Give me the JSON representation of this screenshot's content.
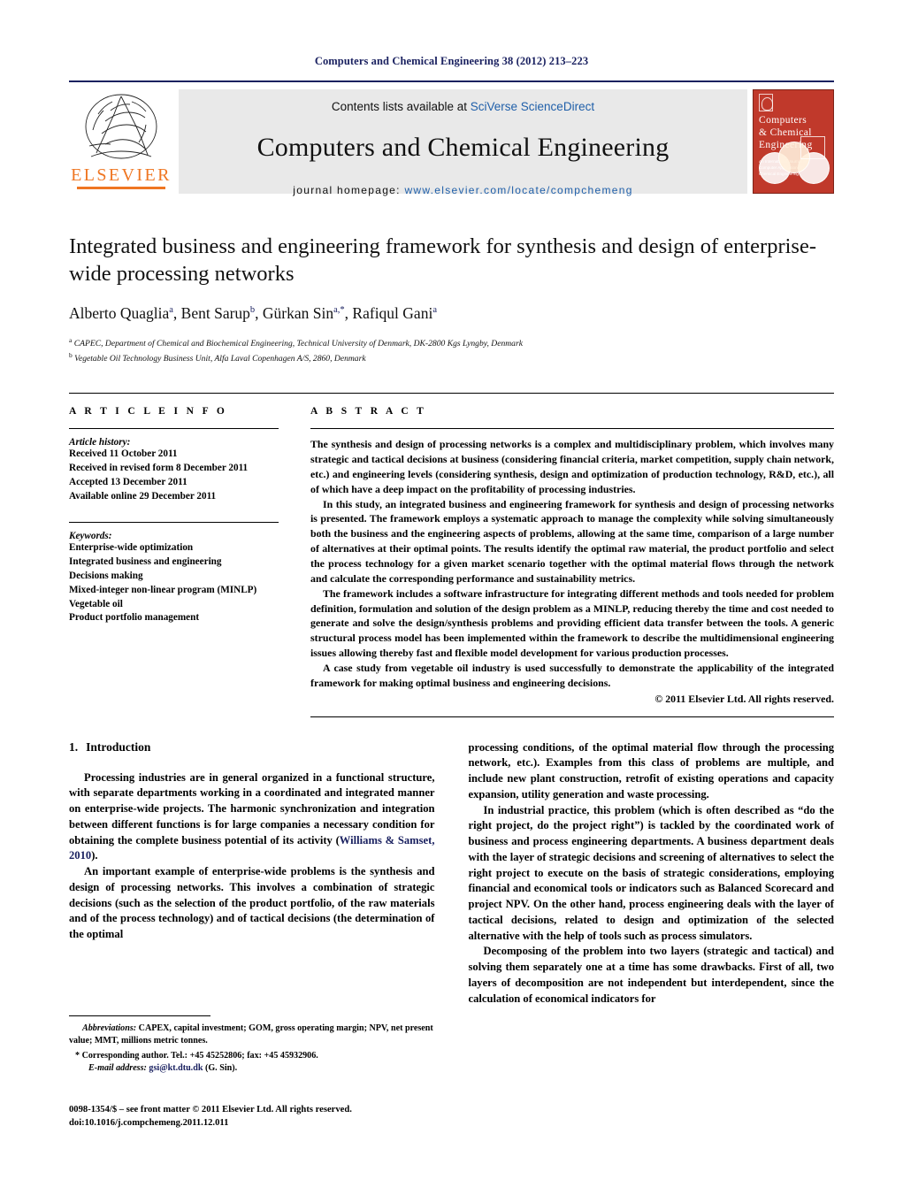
{
  "running_head": "Computers and Chemical Engineering 38 (2012) 213–223",
  "masthead": {
    "contents_prefix": "Contents lists available at ",
    "contents_link": "SciVerse ScienceDirect",
    "journal_title": "Computers and Chemical Engineering",
    "homepage_label": "journal homepage:",
    "homepage_url": "www.elsevier.com/locate/compchemeng",
    "publisher": "ELSEVIER",
    "cover": {
      "title_line1": "Computers",
      "title_line2": "& Chemical",
      "title_line3": "Engineering",
      "subtitle": "An International Journal of Computer Applications in Chemical Engineering"
    }
  },
  "article": {
    "title": "Integrated business and engineering framework for synthesis and design of enterprise-wide processing networks",
    "authors": [
      {
        "name": "Alberto Quaglia",
        "marks": "a"
      },
      {
        "name": "Bent Sarup",
        "marks": "b"
      },
      {
        "name": "Gürkan Sin",
        "marks": "a,*"
      },
      {
        "name": "Rafiqul Gani",
        "marks": "a"
      }
    ],
    "affiliations": [
      {
        "mark": "a",
        "text": "CAPEC, Department of Chemical and Biochemical Engineering, Technical University of Denmark, DK-2800 Kgs Lyngby, Denmark"
      },
      {
        "mark": "b",
        "text": "Vegetable Oil Technology Business Unit, Alfa Laval Copenhagen A/S, 2860, Denmark"
      }
    ]
  },
  "article_info": {
    "heading": "A R T I C L E   I N F O",
    "history_label": "Article history:",
    "history": [
      "Received 11 October 2011",
      "Received in revised form 8 December 2011",
      "Accepted 13 December 2011",
      "Available online 29 December 2011"
    ],
    "keywords_label": "Keywords:",
    "keywords": [
      "Enterprise-wide optimization",
      "Integrated business and engineering",
      "Decisions making",
      "Mixed-integer non-linear program (MINLP)",
      "Vegetable oil",
      "Product portfolio management"
    ]
  },
  "abstract": {
    "heading": "A B S T R A C T",
    "paragraphs": [
      "The synthesis and design of processing networks is a complex and multidisciplinary problem, which involves many strategic and tactical decisions at business (considering financial criteria, market competition, supply chain network, etc.) and engineering levels (considering synthesis, design and optimization of production technology, R&D, etc.), all of which have a deep impact on the profitability of processing industries.",
      "In this study, an integrated business and engineering framework for synthesis and design of processing networks is presented. The framework employs a systematic approach to manage the complexity while solving simultaneously both the business and the engineering aspects of problems, allowing at the same time, comparison of a large number of alternatives at their optimal points. The results identify the optimal raw material, the product portfolio and select the process technology for a given market scenario together with the optimal material flows through the network and calculate the corresponding performance and sustainability metrics.",
      "The framework includes a software infrastructure for integrating different methods and tools needed for problem definition, formulation and solution of the design problem as a MINLP, reducing thereby the time and cost needed to generate and solve the design/synthesis problems and providing efficient data transfer between the tools. A generic structural process model has been implemented within the framework to describe the multidimensional engineering issues allowing thereby fast and flexible model development for various production processes.",
      "A case study from vegetable oil industry is used successfully to demonstrate the applicability of the integrated framework for making optimal business and engineering decisions."
    ],
    "copyright": "© 2011 Elsevier Ltd. All rights reserved."
  },
  "body": {
    "section_number": "1.",
    "section_title": "Introduction",
    "left_paragraphs": [
      "Processing industries are in general organized in a functional structure, with separate departments working in a coordinated and integrated manner on enterprise-wide projects. The harmonic synchronization and integration between different functions is for large companies a necessary condition for obtaining the complete business potential of its activity (",
      "An important example of enterprise-wide problems is the synthesis and design of processing networks. This involves a combination of strategic decisions (such as the selection of the product portfolio, of the raw materials and of the process technology) and of tactical decisions (the determination of the optimal"
    ],
    "left_citation": "Williams & Samset, 2010",
    "left_citation_tail": ").",
    "right_paragraphs": [
      "processing conditions, of the optimal material flow through the processing network, etc.). Examples from this class of problems are multiple, and include new plant construction, retrofit of existing operations and capacity expansion, utility generation and waste processing.",
      "In industrial practice, this problem (which is often described as “do the right project, do the project right”) is tackled by the coordinated work of business and process engineering departments. A business department deals with the layer of strategic decisions and screening of alternatives to select the right project to execute on the basis of strategic considerations, employing financial and economical tools or indicators such as Balanced Scorecard and project NPV. On the other hand, process engineering deals with the layer of tactical decisions, related to design and optimization of the selected alternative with the help of tools such as process simulators.",
      "Decomposing of the problem into two layers (strategic and tactical) and solving them separately one at a time has some drawbacks. First of all, two layers of decomposition are not independent but interdependent, since the calculation of economical indicators for"
    ]
  },
  "footnotes": {
    "abbrev_label": "Abbreviations:",
    "abbrev_text": "CAPEX, capital investment; GOM, gross operating margin; NPV, net present value; MMT, millions metric tonnes.",
    "corresponding": "* Corresponding author. Tel.: +45 45252806; fax: +45 45932906.",
    "email_label": "E-mail address:",
    "email": "gsi@kt.dtu.dk",
    "email_suffix": "(G. Sin).",
    "issn_line": "0098-1354/$ – see front matter © 2011 Elsevier Ltd. All rights reserved.",
    "doi_line": "doi:10.1016/j.compchemeng.2011.12.011"
  },
  "colors": {
    "link_blue": "#1f5fa9",
    "navy": "#1a2160",
    "elsevier_orange": "#ef7622",
    "cover_red": "#c0392b",
    "masthead_grey": "#e9e9e9"
  }
}
